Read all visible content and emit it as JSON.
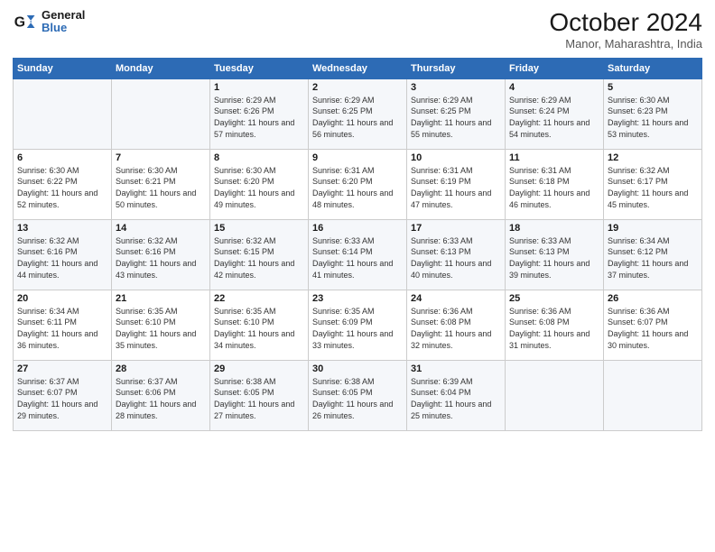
{
  "header": {
    "logo_line1": "General",
    "logo_line2": "Blue",
    "title": "October 2024",
    "subtitle": "Manor, Maharashtra, India"
  },
  "weekdays": [
    "Sunday",
    "Monday",
    "Tuesday",
    "Wednesday",
    "Thursday",
    "Friday",
    "Saturday"
  ],
  "weeks": [
    [
      {
        "day": "",
        "sunrise": "",
        "sunset": "",
        "daylight": ""
      },
      {
        "day": "",
        "sunrise": "",
        "sunset": "",
        "daylight": ""
      },
      {
        "day": "1",
        "sunrise": "Sunrise: 6:29 AM",
        "sunset": "Sunset: 6:26 PM",
        "daylight": "Daylight: 11 hours and 57 minutes."
      },
      {
        "day": "2",
        "sunrise": "Sunrise: 6:29 AM",
        "sunset": "Sunset: 6:25 PM",
        "daylight": "Daylight: 11 hours and 56 minutes."
      },
      {
        "day": "3",
        "sunrise": "Sunrise: 6:29 AM",
        "sunset": "Sunset: 6:25 PM",
        "daylight": "Daylight: 11 hours and 55 minutes."
      },
      {
        "day": "4",
        "sunrise": "Sunrise: 6:29 AM",
        "sunset": "Sunset: 6:24 PM",
        "daylight": "Daylight: 11 hours and 54 minutes."
      },
      {
        "day": "5",
        "sunrise": "Sunrise: 6:30 AM",
        "sunset": "Sunset: 6:23 PM",
        "daylight": "Daylight: 11 hours and 53 minutes."
      }
    ],
    [
      {
        "day": "6",
        "sunrise": "Sunrise: 6:30 AM",
        "sunset": "Sunset: 6:22 PM",
        "daylight": "Daylight: 11 hours and 52 minutes."
      },
      {
        "day": "7",
        "sunrise": "Sunrise: 6:30 AM",
        "sunset": "Sunset: 6:21 PM",
        "daylight": "Daylight: 11 hours and 50 minutes."
      },
      {
        "day": "8",
        "sunrise": "Sunrise: 6:30 AM",
        "sunset": "Sunset: 6:20 PM",
        "daylight": "Daylight: 11 hours and 49 minutes."
      },
      {
        "day": "9",
        "sunrise": "Sunrise: 6:31 AM",
        "sunset": "Sunset: 6:20 PM",
        "daylight": "Daylight: 11 hours and 48 minutes."
      },
      {
        "day": "10",
        "sunrise": "Sunrise: 6:31 AM",
        "sunset": "Sunset: 6:19 PM",
        "daylight": "Daylight: 11 hours and 47 minutes."
      },
      {
        "day": "11",
        "sunrise": "Sunrise: 6:31 AM",
        "sunset": "Sunset: 6:18 PM",
        "daylight": "Daylight: 11 hours and 46 minutes."
      },
      {
        "day": "12",
        "sunrise": "Sunrise: 6:32 AM",
        "sunset": "Sunset: 6:17 PM",
        "daylight": "Daylight: 11 hours and 45 minutes."
      }
    ],
    [
      {
        "day": "13",
        "sunrise": "Sunrise: 6:32 AM",
        "sunset": "Sunset: 6:16 PM",
        "daylight": "Daylight: 11 hours and 44 minutes."
      },
      {
        "day": "14",
        "sunrise": "Sunrise: 6:32 AM",
        "sunset": "Sunset: 6:16 PM",
        "daylight": "Daylight: 11 hours and 43 minutes."
      },
      {
        "day": "15",
        "sunrise": "Sunrise: 6:32 AM",
        "sunset": "Sunset: 6:15 PM",
        "daylight": "Daylight: 11 hours and 42 minutes."
      },
      {
        "day": "16",
        "sunrise": "Sunrise: 6:33 AM",
        "sunset": "Sunset: 6:14 PM",
        "daylight": "Daylight: 11 hours and 41 minutes."
      },
      {
        "day": "17",
        "sunrise": "Sunrise: 6:33 AM",
        "sunset": "Sunset: 6:13 PM",
        "daylight": "Daylight: 11 hours and 40 minutes."
      },
      {
        "day": "18",
        "sunrise": "Sunrise: 6:33 AM",
        "sunset": "Sunset: 6:13 PM",
        "daylight": "Daylight: 11 hours and 39 minutes."
      },
      {
        "day": "19",
        "sunrise": "Sunrise: 6:34 AM",
        "sunset": "Sunset: 6:12 PM",
        "daylight": "Daylight: 11 hours and 37 minutes."
      }
    ],
    [
      {
        "day": "20",
        "sunrise": "Sunrise: 6:34 AM",
        "sunset": "Sunset: 6:11 PM",
        "daylight": "Daylight: 11 hours and 36 minutes."
      },
      {
        "day": "21",
        "sunrise": "Sunrise: 6:35 AM",
        "sunset": "Sunset: 6:10 PM",
        "daylight": "Daylight: 11 hours and 35 minutes."
      },
      {
        "day": "22",
        "sunrise": "Sunrise: 6:35 AM",
        "sunset": "Sunset: 6:10 PM",
        "daylight": "Daylight: 11 hours and 34 minutes."
      },
      {
        "day": "23",
        "sunrise": "Sunrise: 6:35 AM",
        "sunset": "Sunset: 6:09 PM",
        "daylight": "Daylight: 11 hours and 33 minutes."
      },
      {
        "day": "24",
        "sunrise": "Sunrise: 6:36 AM",
        "sunset": "Sunset: 6:08 PM",
        "daylight": "Daylight: 11 hours and 32 minutes."
      },
      {
        "day": "25",
        "sunrise": "Sunrise: 6:36 AM",
        "sunset": "Sunset: 6:08 PM",
        "daylight": "Daylight: 11 hours and 31 minutes."
      },
      {
        "day": "26",
        "sunrise": "Sunrise: 6:36 AM",
        "sunset": "Sunset: 6:07 PM",
        "daylight": "Daylight: 11 hours and 30 minutes."
      }
    ],
    [
      {
        "day": "27",
        "sunrise": "Sunrise: 6:37 AM",
        "sunset": "Sunset: 6:07 PM",
        "daylight": "Daylight: 11 hours and 29 minutes."
      },
      {
        "day": "28",
        "sunrise": "Sunrise: 6:37 AM",
        "sunset": "Sunset: 6:06 PM",
        "daylight": "Daylight: 11 hours and 28 minutes."
      },
      {
        "day": "29",
        "sunrise": "Sunrise: 6:38 AM",
        "sunset": "Sunset: 6:05 PM",
        "daylight": "Daylight: 11 hours and 27 minutes."
      },
      {
        "day": "30",
        "sunrise": "Sunrise: 6:38 AM",
        "sunset": "Sunset: 6:05 PM",
        "daylight": "Daylight: 11 hours and 26 minutes."
      },
      {
        "day": "31",
        "sunrise": "Sunrise: 6:39 AM",
        "sunset": "Sunset: 6:04 PM",
        "daylight": "Daylight: 11 hours and 25 minutes."
      },
      {
        "day": "",
        "sunrise": "",
        "sunset": "",
        "daylight": ""
      },
      {
        "day": "",
        "sunrise": "",
        "sunset": "",
        "daylight": ""
      }
    ]
  ]
}
